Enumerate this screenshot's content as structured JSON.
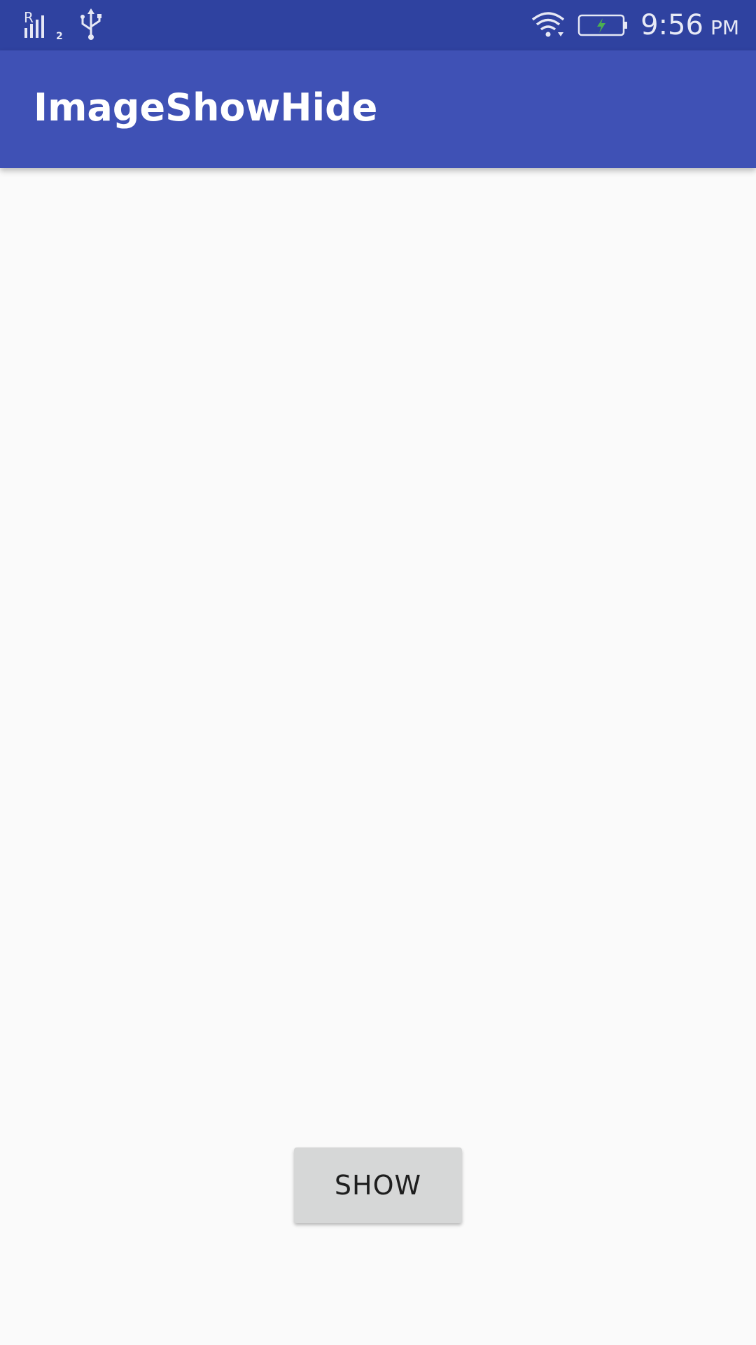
{
  "status_bar": {
    "time": "9:56",
    "ampm": "PM",
    "sim_indicator": "R",
    "sim_slot": "2",
    "icons": [
      "signal-icon",
      "usb-icon",
      "wifi-icon",
      "battery-charging-icon"
    ],
    "background_color": "#2f42a0"
  },
  "app_bar": {
    "title": "ImageShowHide",
    "background_color": "#3f51b5"
  },
  "main": {
    "show_button_label": "SHOW",
    "background_color": "#fafafa"
  }
}
